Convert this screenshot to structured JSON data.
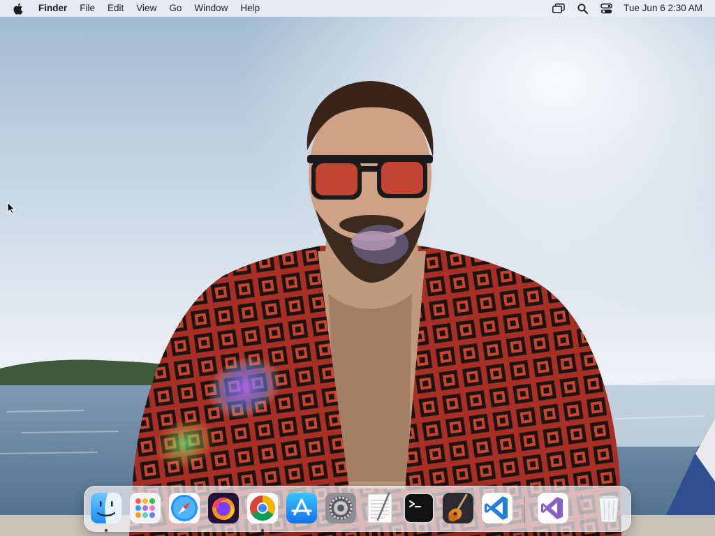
{
  "menubar": {
    "app_name": "Finder",
    "menus": [
      "File",
      "Edit",
      "View",
      "Go",
      "Window",
      "Help"
    ],
    "clock": "Tue Jun 6  2:30 AM",
    "status_icons": [
      "screen-mirroring-icon",
      "spotlight-search-icon",
      "control-center-icon"
    ]
  },
  "dock": {
    "apps": [
      {
        "name": "Finder",
        "icon": "finder-icon",
        "running": true
      },
      {
        "name": "Launchpad",
        "icon": "launchpad-icon",
        "running": false
      },
      {
        "name": "Safari",
        "icon": "safari-icon",
        "running": false
      },
      {
        "name": "Firefox",
        "icon": "firefox-icon",
        "running": false
      },
      {
        "name": "Google Chrome",
        "icon": "chrome-icon",
        "running": true
      },
      {
        "name": "App Store",
        "icon": "app-store-icon",
        "running": false
      },
      {
        "name": "System Preferences",
        "icon": "system-preferences-icon",
        "running": false
      },
      {
        "name": "TextEdit",
        "icon": "textedit-icon",
        "running": false
      },
      {
        "name": "Terminal",
        "icon": "terminal-icon",
        "running": false
      },
      {
        "name": "GarageBand",
        "icon": "garageband-icon",
        "running": false
      },
      {
        "name": "Visual Studio Code",
        "icon": "vscode-icon",
        "running": false
      },
      {
        "name": "Visual Studio",
        "icon": "visual-studio-icon",
        "running": false
      },
      {
        "name": "Trash",
        "icon": "trash-icon",
        "running": false
      }
    ]
  },
  "colors": {
    "menubar_bg": "#eceef2",
    "sky": "#c9d8e6",
    "sea": "#5f7f9c",
    "robe": "#b8352a",
    "lens": "#c0392b"
  }
}
